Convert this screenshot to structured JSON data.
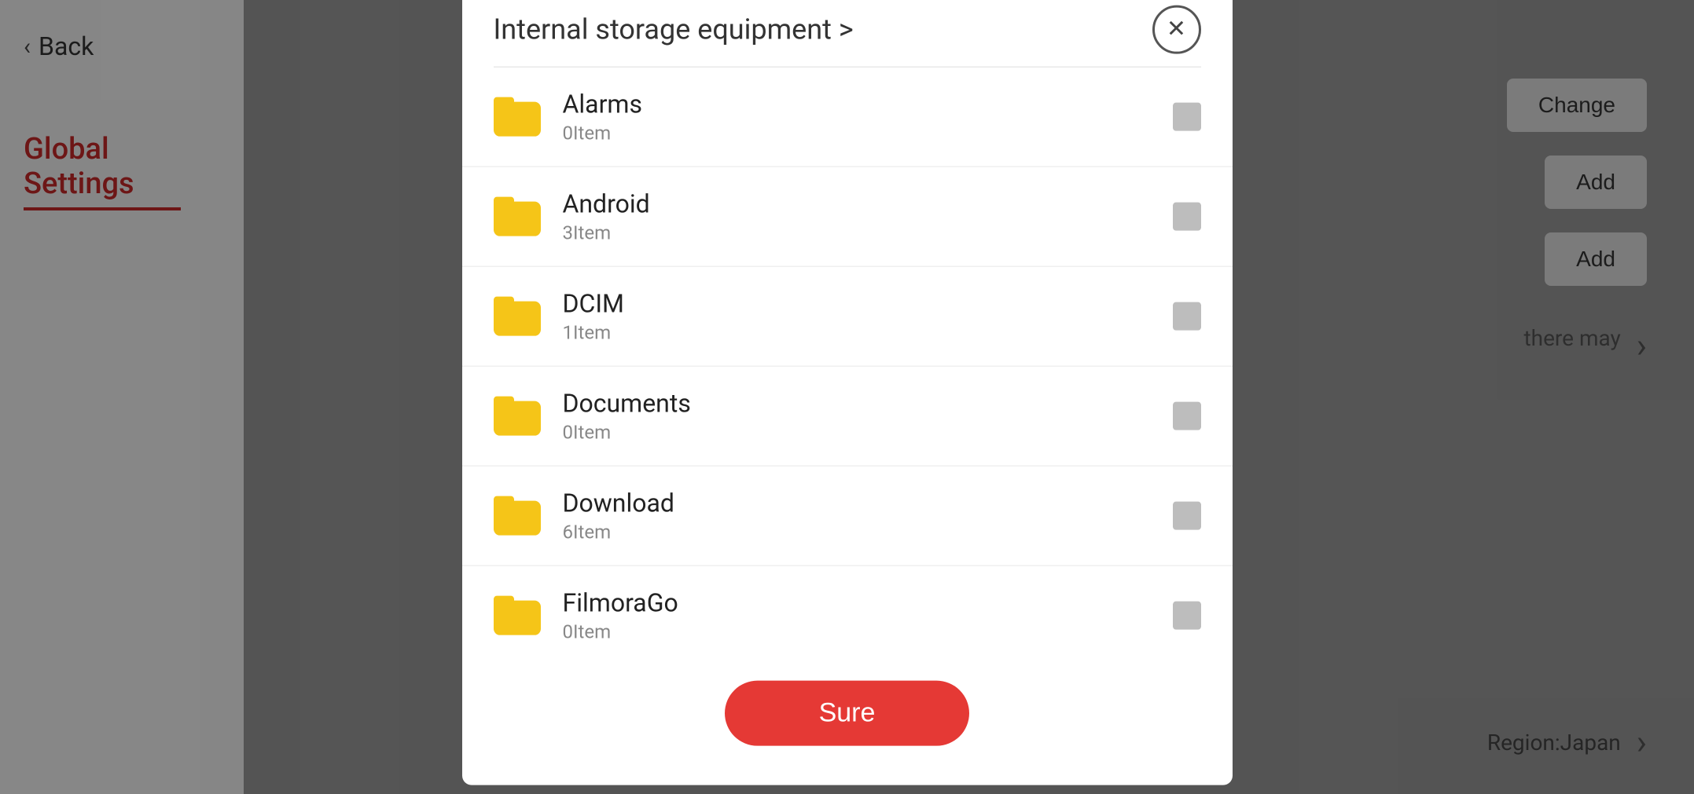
{
  "background": {
    "back_label": "Back",
    "global_settings_label": "Global Settings",
    "change_button": "Change",
    "add_button_1": "Add",
    "add_button_2": "Add",
    "info_text": "there may",
    "right_arrow": "›",
    "region_label": "Region:Japan"
  },
  "dialog": {
    "title": "Internal storage equipment >",
    "close_icon": "✕",
    "folders": [
      {
        "name": "Alarms",
        "count": "0Item"
      },
      {
        "name": "Android",
        "count": "3Item"
      },
      {
        "name": "DCIM",
        "count": "1Item"
      },
      {
        "name": "Documents",
        "count": "0Item"
      },
      {
        "name": "Download",
        "count": "6Item"
      },
      {
        "name": "FilmoraGo",
        "count": "0Item"
      }
    ],
    "sure_button": "Sure"
  }
}
